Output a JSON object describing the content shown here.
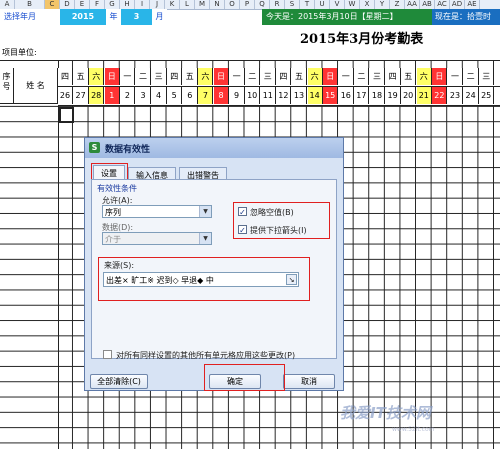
{
  "columns": [
    "A",
    "B",
    "C",
    "D",
    "E",
    "F",
    "G",
    "H",
    "I",
    "J",
    "K",
    "L",
    "M",
    "N",
    "O",
    "P",
    "Q",
    "R",
    "S",
    "T",
    "U",
    "V",
    "W",
    "X",
    "Y",
    "Z",
    "AA",
    "AB",
    "AC",
    "AD",
    "AE"
  ],
  "header_row": {
    "select_year_label": "选择年月",
    "year": "2015",
    "year_unit": "年",
    "month": "3",
    "month_unit": "月",
    "today": "今天是：2015年3月10日【星期二】",
    "now": "现在是：拾壹时"
  },
  "sheet": {
    "title": "2015年3月份考勤表",
    "unit_label": "项目单位:",
    "seq_label": "序号",
    "name_label": "姓  名",
    "weekdays": [
      "四",
      "五",
      "六",
      "日",
      "一",
      "二",
      "三",
      "四",
      "五",
      "六",
      "日",
      "一",
      "二",
      "三",
      "四",
      "五",
      "六",
      "日",
      "一",
      "二",
      "三",
      "四",
      "五",
      "六",
      "日",
      "一",
      "二",
      "三"
    ],
    "dates": [
      "26",
      "27",
      "28",
      "1",
      "2",
      "3",
      "4",
      "5",
      "6",
      "7",
      "8",
      "9",
      "10",
      "11",
      "12",
      "13",
      "14",
      "15",
      "16",
      "17",
      "18",
      "19",
      "20",
      "21",
      "22",
      "23",
      "24",
      "25"
    ]
  },
  "dialog": {
    "title": "数据有效性",
    "tabs": [
      "设置",
      "输入信息",
      "出错警告"
    ],
    "group_label": "有效性条件",
    "allow_label": "允许(A):",
    "allow_value": "序列",
    "data_label": "数据(D):",
    "data_value": "介于",
    "ignore_blank": "忽略空值(B)",
    "dropdown": "提供下拉箭头(I)",
    "source_label": "来源(S):",
    "source_value": "出差×   旷工※   迟到◇   早退◆   中",
    "apply_all": "对所有同样设置的其他所有单元格应用这些更改(P)",
    "clear_all": "全部清除(C)",
    "ok": "确定",
    "cancel": "取消"
  },
  "watermark": "我爱IT技术网",
  "watermark_sub": "www.52it.com"
}
